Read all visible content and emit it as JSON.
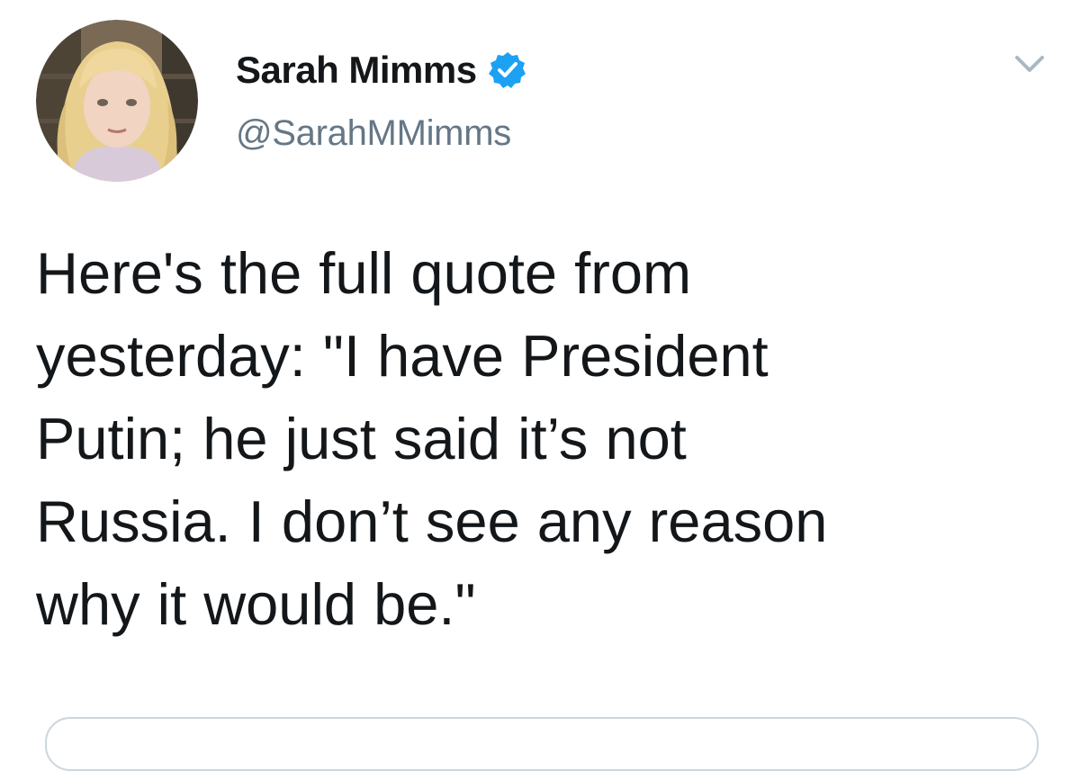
{
  "tweet": {
    "author": {
      "display_name": "Sarah Mimms",
      "handle": "@SarahMMimms",
      "verified": true,
      "avatar_icon": "profile-photo"
    },
    "menu_icon": "chevron-down-icon",
    "text_lines": [
      "Here's the full quote from",
      "yesterday: \"I have President",
      "Putin; he just said it’s not",
      "Russia. I don’t see any reason",
      "why it would be.\""
    ]
  },
  "colors": {
    "name_text": "#14171a",
    "handle_text": "#657786",
    "verified_badge": "#1da1f2",
    "border": "#ccd6dd",
    "background": "#ffffff"
  }
}
